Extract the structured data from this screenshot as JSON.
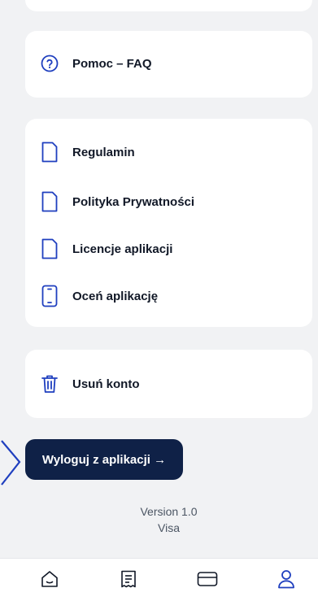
{
  "help": {
    "faq_label": "Pomoc – FAQ"
  },
  "legal": {
    "items": [
      {
        "label": "Regulamin",
        "icon": "document-icon"
      },
      {
        "label": "Polityka Prywatności",
        "icon": "document-icon"
      },
      {
        "label": "Licencje aplikacji",
        "icon": "document-icon"
      },
      {
        "label": "Oceń aplikację",
        "icon": "phone-icon"
      }
    ]
  },
  "account": {
    "delete_label": "Usuń konto"
  },
  "logout": {
    "label": "Wyloguj z aplikacji →"
  },
  "footer": {
    "version": "Version 1.0",
    "brand": "Visa"
  },
  "bottom_nav": [
    {
      "name": "home",
      "icon": "home-icon"
    },
    {
      "name": "receipts",
      "icon": "receipt-icon"
    },
    {
      "name": "cards",
      "icon": "card-icon"
    },
    {
      "name": "profile",
      "icon": "profile-icon",
      "active": true
    }
  ],
  "colors": {
    "accent": "#1f3fbf",
    "button_bg": "#0f2147",
    "background": "#f1f2f4"
  }
}
